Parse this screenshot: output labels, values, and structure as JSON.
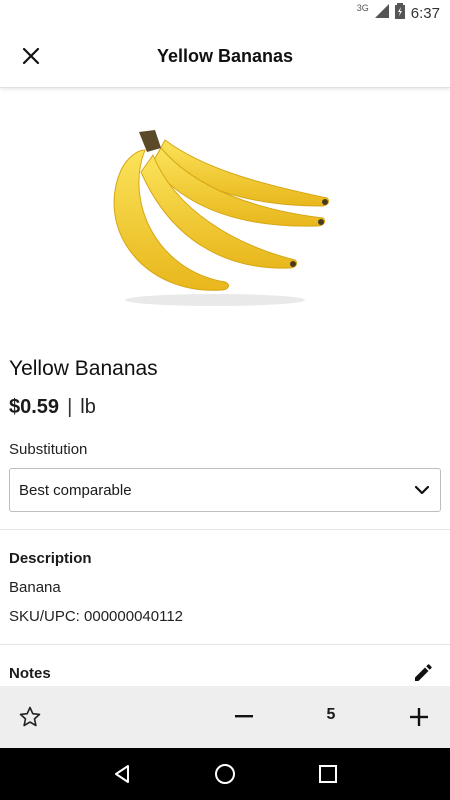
{
  "status": {
    "network": "3G",
    "time": "6:37"
  },
  "header": {
    "title": "Yellow Bananas"
  },
  "product": {
    "name": "Yellow Bananas",
    "price": "$0.59",
    "separator": "|",
    "unit": "lb"
  },
  "substitution": {
    "label": "Substitution",
    "selected": "Best comparable"
  },
  "description": {
    "title": "Description",
    "text": "Banana",
    "sku": "SKU/UPC: 000000040112"
  },
  "notes": {
    "title": "Notes"
  },
  "cart": {
    "quantity": "5"
  },
  "icons": {
    "close": "close-icon",
    "dropdown": "chevron-down-icon",
    "edit": "pencil-icon",
    "favorite": "star-outline-icon",
    "decrement": "minus-icon",
    "increment": "plus-icon",
    "back": "back-triangle-icon",
    "home": "home-circle-icon",
    "recents": "recents-square-icon"
  },
  "colors": {
    "bottom_bar": "#eeeeee",
    "nav_bar": "#000000",
    "banana": "#f5d232"
  }
}
